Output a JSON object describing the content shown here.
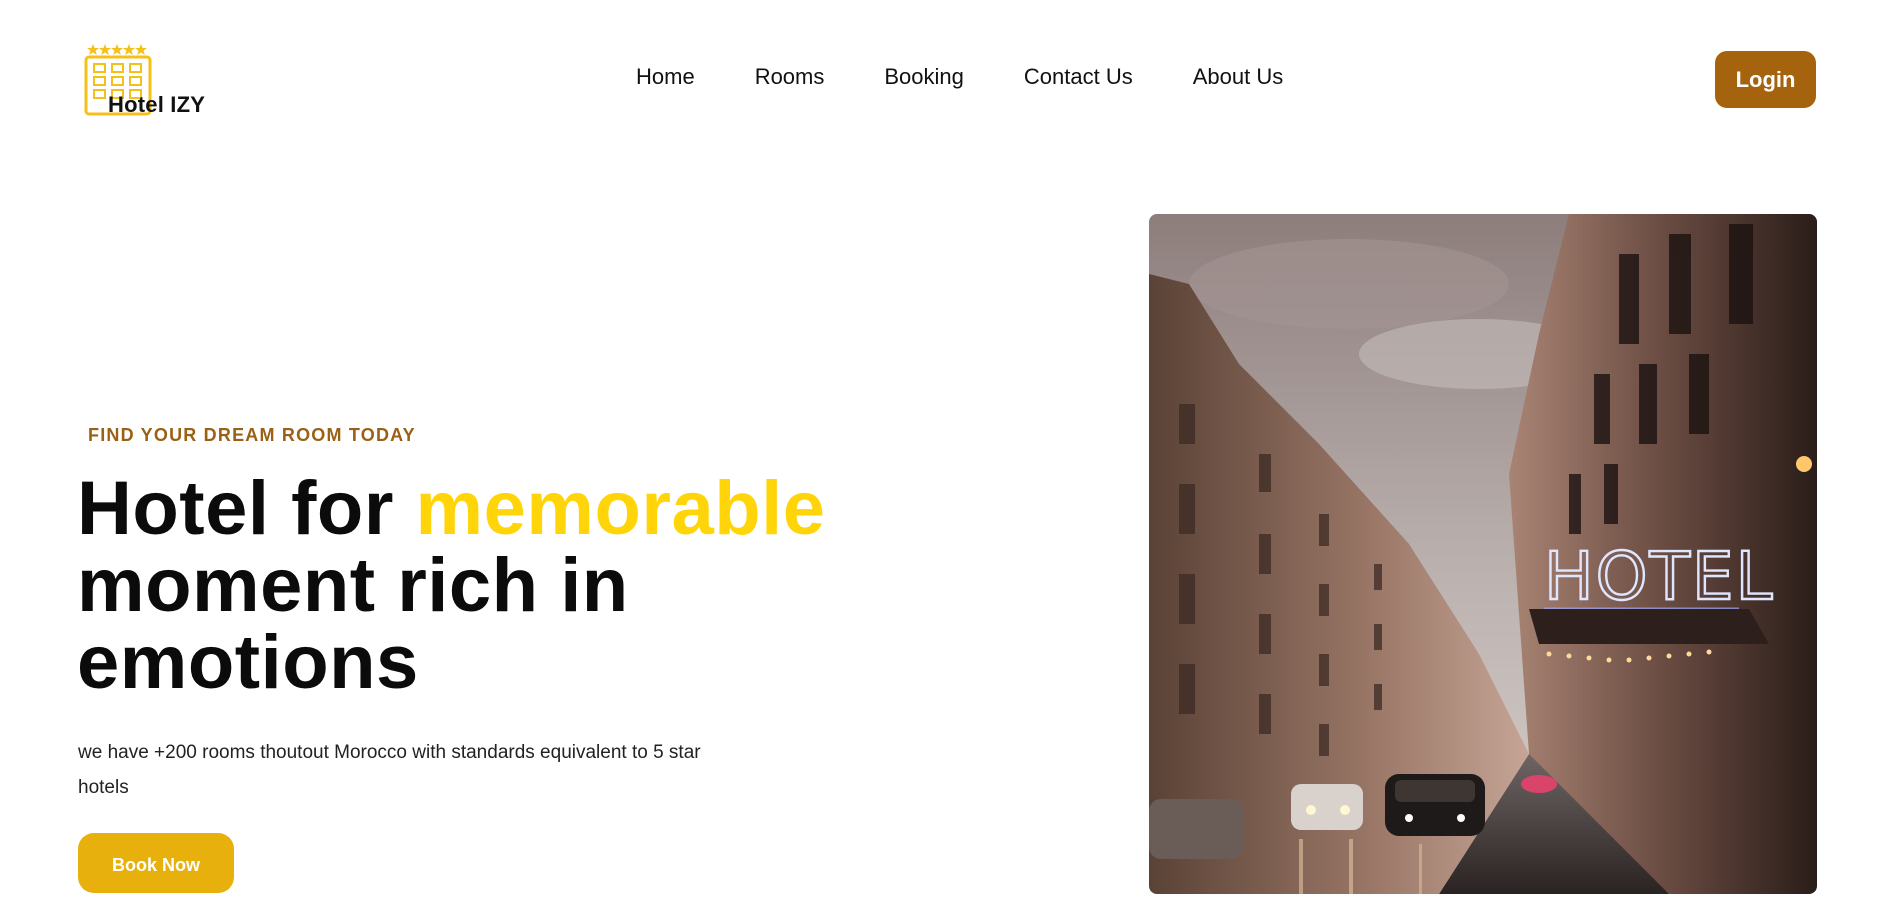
{
  "header": {
    "logo_text": "Hotel IZY",
    "logo_icon": "hotel-building-icon",
    "nav": [
      "Home",
      "Rooms",
      "Booking",
      "Contact Us",
      "About Us"
    ],
    "login_label": "Login"
  },
  "hero": {
    "eyebrow": "FIND YOUR DREAM ROOM TODAY",
    "headline_prefix": "Hotel for ",
    "headline_accent": "memorable",
    "headline_rest": "moment rich in emotions",
    "description": "we have +200 rooms thoutout Morocco with standards equivalent to 5 star hotels",
    "cta_label": "Book Now",
    "image_sign_text": "HOTEL"
  },
  "colors": {
    "brand_brown": "#a5630d",
    "accent_yellow": "#ffd50a",
    "cta_yellow": "#e8b00c",
    "eyebrow": "#9a6115"
  }
}
